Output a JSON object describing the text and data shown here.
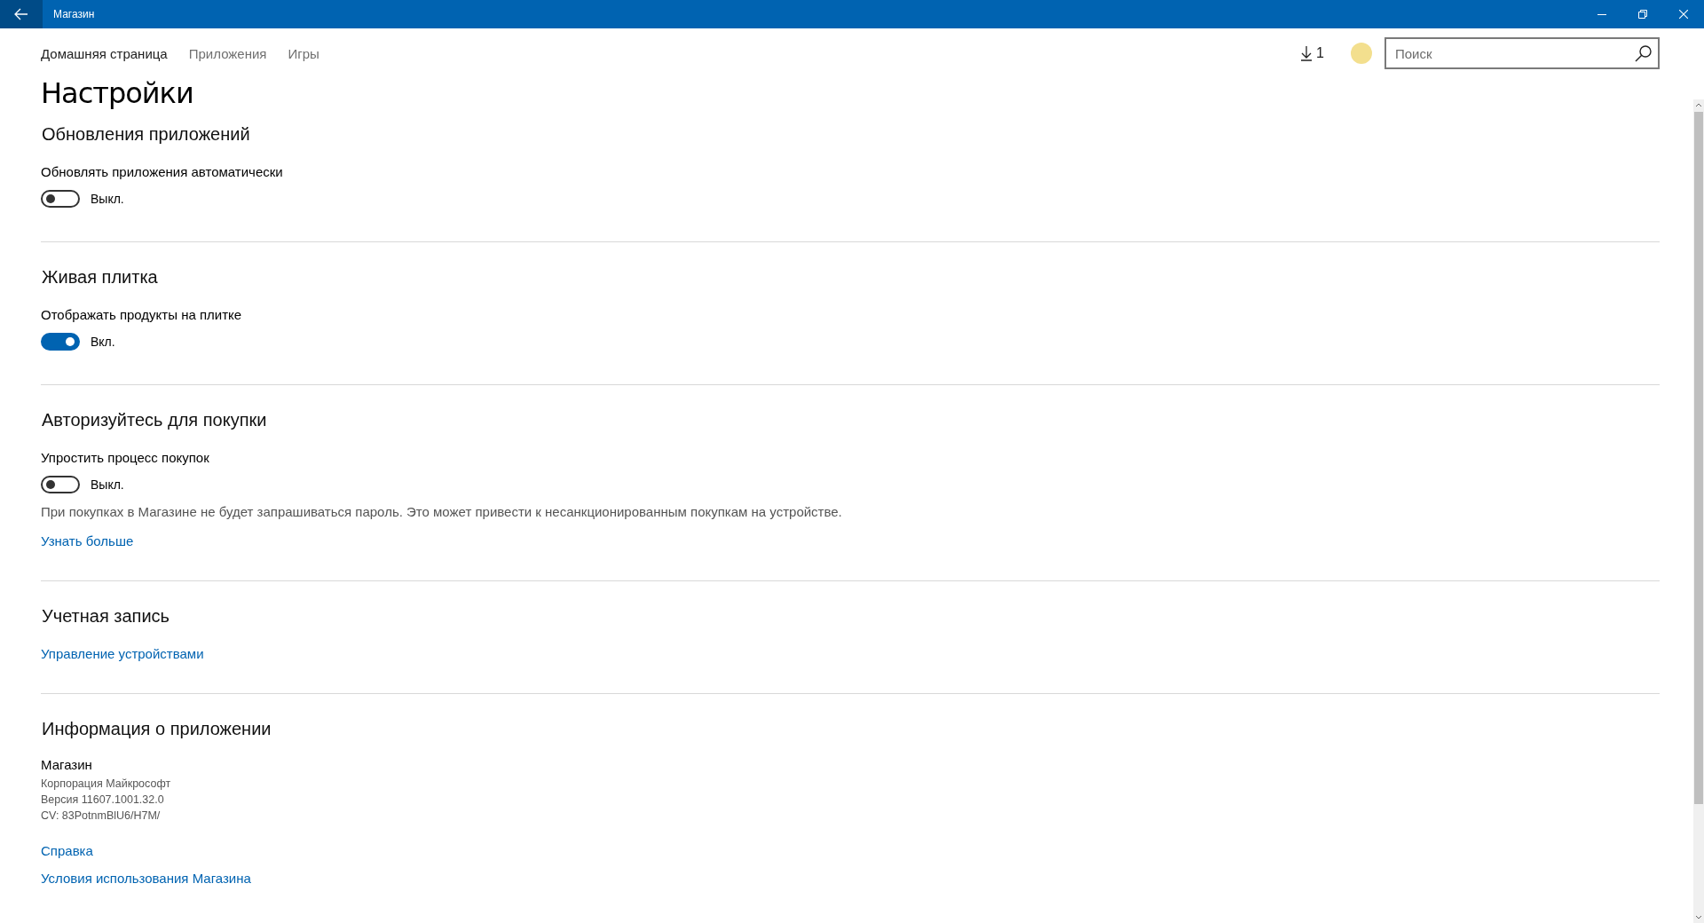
{
  "window": {
    "title": "Магазин"
  },
  "nav": [
    {
      "label": "Домашняя страница",
      "selected": true
    },
    {
      "label": "Приложения",
      "selected": false
    },
    {
      "label": "Игры",
      "selected": false
    }
  ],
  "downloads": {
    "count": "1"
  },
  "search": {
    "placeholder": "Поиск"
  },
  "page_title": "Настройки",
  "sections": [
    {
      "title": "Обновления приложений",
      "items": [
        {
          "kind": "toggle",
          "label": "Обновлять приложения автоматически",
          "on": false,
          "state_text": "Выкл."
        }
      ]
    },
    {
      "title": "Живая плитка",
      "items": [
        {
          "kind": "toggle",
          "label": "Отображать продукты на плитке",
          "on": true,
          "state_text": "Вкл."
        }
      ]
    },
    {
      "title": "Авторизуйтесь для покупки",
      "items": [
        {
          "kind": "toggle",
          "label": "Упростить процесс покупок",
          "on": false,
          "state_text": "Выкл."
        },
        {
          "kind": "note",
          "text": "При покупках в Магазине не будет запрашиваться пароль. Это может привести к несанкционированным покупкам на устройстве."
        },
        {
          "kind": "link",
          "text": "Узнать больше"
        }
      ]
    },
    {
      "title": "Учетная запись",
      "items": [
        {
          "kind": "link",
          "text": "Управление устройствами"
        }
      ]
    },
    {
      "title": "Информация о приложении",
      "items": [
        {
          "kind": "info",
          "name": "Магазин",
          "lines": [
            "Корпорация Майкрософт",
            "Версия 11607.1001.32.0",
            "CV: 83PotnmBlU6/H7M/"
          ]
        },
        {
          "kind": "link",
          "text": "Справка"
        },
        {
          "kind": "link",
          "text": "Условия использования Магазина"
        }
      ]
    }
  ]
}
